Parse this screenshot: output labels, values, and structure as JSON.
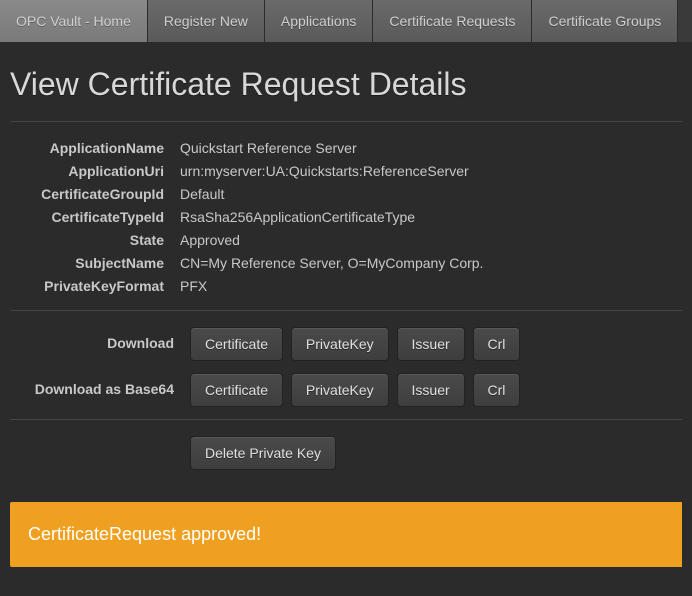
{
  "nav": {
    "items": [
      "OPC Vault - Home",
      "Register New",
      "Applications",
      "Certificate Requests",
      "Certificate Groups"
    ]
  },
  "page": {
    "title": "View Certificate Request Details"
  },
  "details": {
    "applicationName": {
      "label": "ApplicationName",
      "value": "Quickstart Reference Server"
    },
    "applicationUri": {
      "label": "ApplicationUri",
      "value": "urn:myserver:UA:Quickstarts:ReferenceServer"
    },
    "certificateGroupId": {
      "label": "CertificateGroupId",
      "value": "Default"
    },
    "certificateTypeId": {
      "label": "CertificateTypeId",
      "value": "RsaSha256ApplicationCertificateType"
    },
    "state": {
      "label": "State",
      "value": "Approved"
    },
    "subjectName": {
      "label": "SubjectName",
      "value": "CN=My Reference Server, O=MyCompany Corp."
    },
    "privateKeyFormat": {
      "label": "PrivateKeyFormat",
      "value": "PFX"
    }
  },
  "download": {
    "label": "Download",
    "base64Label": "Download as Base64",
    "buttons": {
      "certificate": "Certificate",
      "privateKey": "PrivateKey",
      "issuer": "Issuer",
      "crl": "Crl"
    }
  },
  "actions": {
    "deletePrivateKey": "Delete Private Key"
  },
  "alert": {
    "message": "CertificateRequest approved!"
  }
}
